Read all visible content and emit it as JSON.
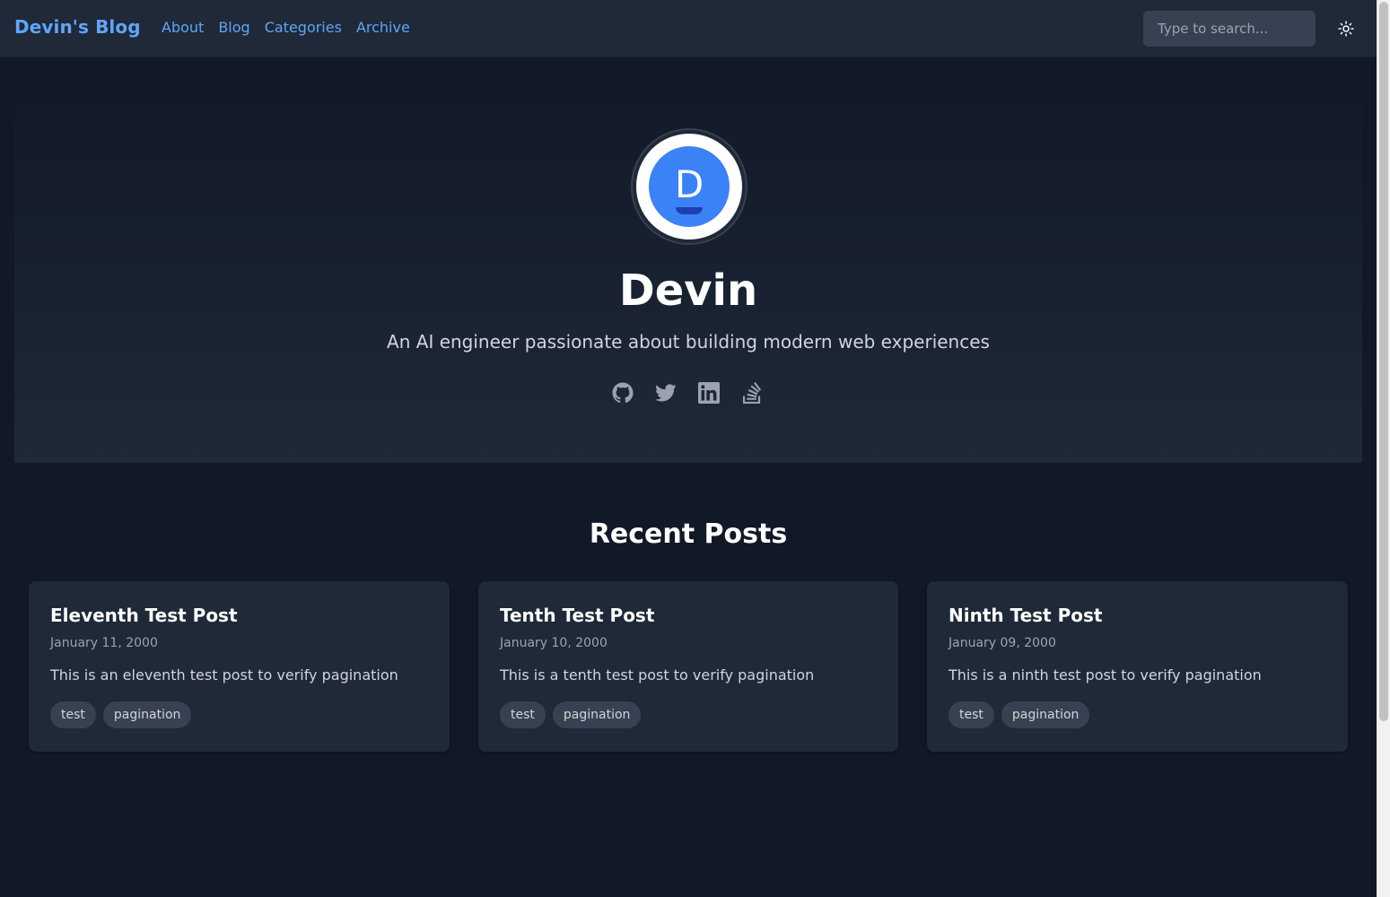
{
  "header": {
    "brand": "Devin's Blog",
    "nav": [
      "About",
      "Blog",
      "Categories",
      "Archive"
    ],
    "search_placeholder": "Type to search..."
  },
  "hero": {
    "avatar_letter": "D",
    "name": "Devin",
    "tagline": "An AI engineer passionate about building modern web experiences",
    "socials": [
      "github-icon",
      "twitter-icon",
      "linkedin-icon",
      "stackoverflow-icon"
    ]
  },
  "recent": {
    "title": "Recent Posts",
    "posts": [
      {
        "title": "Eleventh Test Post",
        "date": "January 11, 2000",
        "excerpt": "This is an eleventh test post to verify pagination",
        "tags": [
          "test",
          "pagination"
        ]
      },
      {
        "title": "Tenth Test Post",
        "date": "January 10, 2000",
        "excerpt": "This is a tenth test post to verify pagination",
        "tags": [
          "test",
          "pagination"
        ]
      },
      {
        "title": "Ninth Test Post",
        "date": "January 09, 2000",
        "excerpt": "This is a ninth test post to verify pagination",
        "tags": [
          "test",
          "pagination"
        ]
      }
    ]
  },
  "colors": {
    "accent": "#60a5fa",
    "background": "#111827",
    "card": "#1f2937",
    "tag": "#374151"
  }
}
